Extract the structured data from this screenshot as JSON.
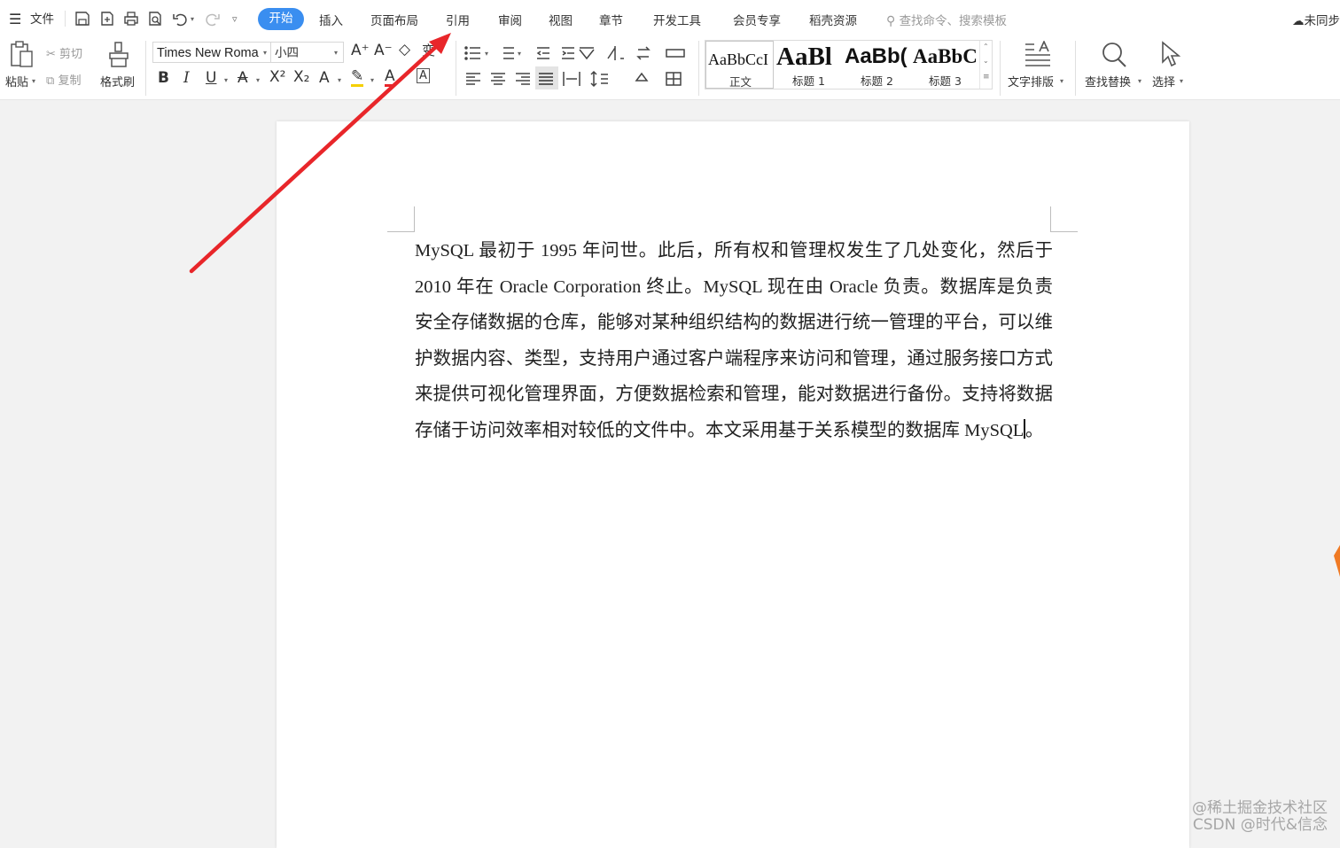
{
  "menubar": {
    "file_label": "文件",
    "tabs": [
      "开始",
      "插入",
      "页面布局",
      "引用",
      "审阅",
      "视图",
      "章节",
      "开发工具",
      "会员专享",
      "稻壳资源"
    ],
    "search_placeholder": "查找命令、搜索模板",
    "cloud_label": "未同步"
  },
  "ribbon": {
    "paste": "粘贴",
    "cut": "剪切",
    "copy": "复制",
    "format_painter": "格式刷",
    "font_name": "Times New Roma",
    "font_size": "小四",
    "bold": "B",
    "italic": "I",
    "underline": "U",
    "styles": [
      {
        "preview": "AaBbCcI",
        "name": "正文"
      },
      {
        "preview": "AaBl",
        "name": "标题 1"
      },
      {
        "preview": "AaBb(",
        "name": "标题 2"
      },
      {
        "preview": "AaBbC",
        "name": "标题 3"
      }
    ],
    "text_layout": "文字排版",
    "find_replace": "查找替换",
    "select": "选择"
  },
  "document": {
    "lines": [
      "MySQL 最初于 1995 年问世。此后，所有权和管理权发生了几处变化，然后于",
      "2010 年在 Oracle Corporation 终止。MySQL 现在由 Oracle 负责。数据库是负责",
      "安全存储数据的仓库，能够对某种组织结构的数据进行统一管理的平台，可以维",
      "护数据内容、类型，支持用户通过客户端程序来访问和管理，通过服务接口方式",
      "来提供可视化管理界面，方便数据检索和管理，能对数据进行备份。支持将数据",
      "存储于访问效率相对较低的文件中。本文采用基于关系模型的数据库 MySQL"
    ],
    "last_punct": "。"
  },
  "watermark": {
    "line1": "@稀土掘金技术社区",
    "line2": "CSDN @时代&信念"
  },
  "colors": {
    "accent": "#3a8ef0",
    "arrow": "#e8262a"
  }
}
